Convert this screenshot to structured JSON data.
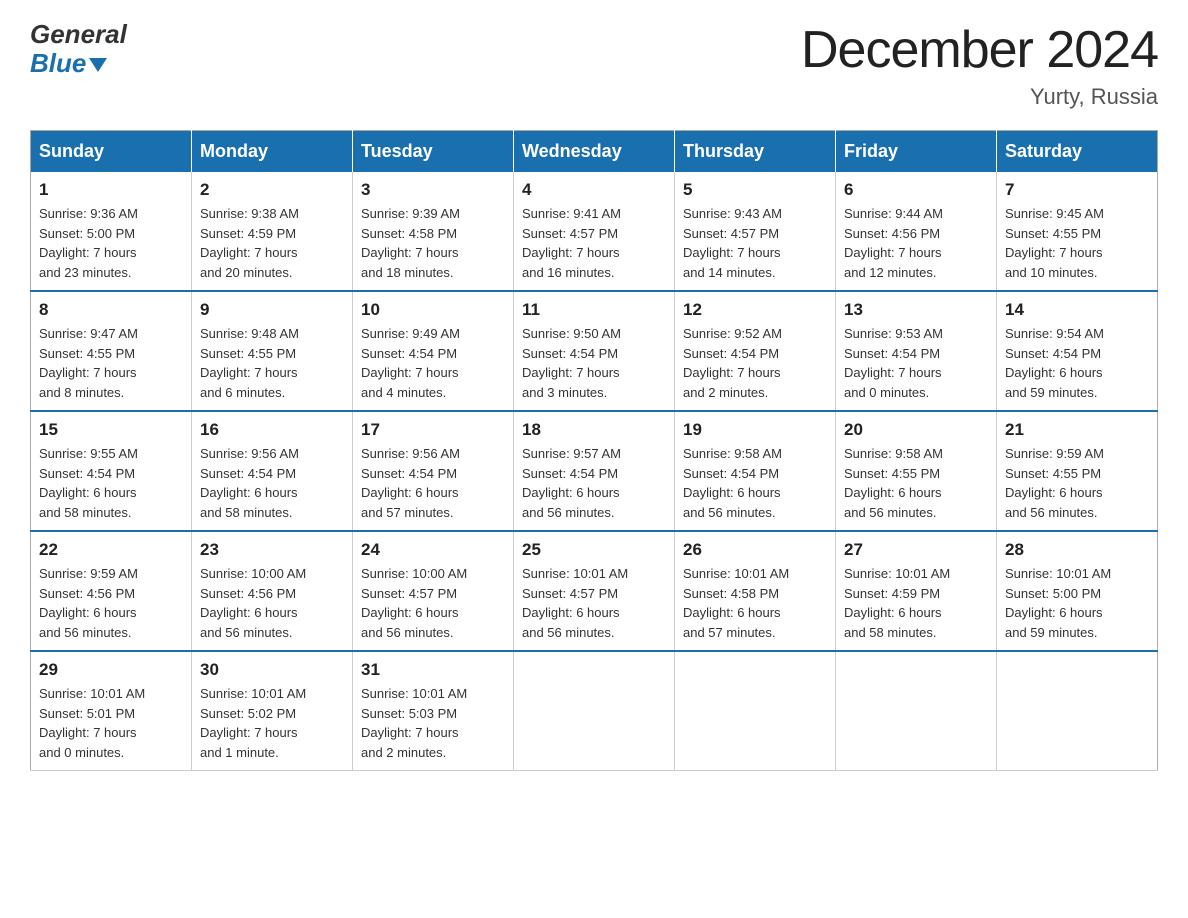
{
  "header": {
    "logo_line1": "General",
    "logo_line2": "Blue",
    "title": "December 2024",
    "subtitle": "Yurty, Russia"
  },
  "weekdays": [
    "Sunday",
    "Monday",
    "Tuesday",
    "Wednesday",
    "Thursday",
    "Friday",
    "Saturday"
  ],
  "weeks": [
    [
      {
        "day": "1",
        "sunrise": "Sunrise: 9:36 AM",
        "sunset": "Sunset: 5:00 PM",
        "daylight": "Daylight: 7 hours",
        "minutes": "and 23 minutes."
      },
      {
        "day": "2",
        "sunrise": "Sunrise: 9:38 AM",
        "sunset": "Sunset: 4:59 PM",
        "daylight": "Daylight: 7 hours",
        "minutes": "and 20 minutes."
      },
      {
        "day": "3",
        "sunrise": "Sunrise: 9:39 AM",
        "sunset": "Sunset: 4:58 PM",
        "daylight": "Daylight: 7 hours",
        "minutes": "and 18 minutes."
      },
      {
        "day": "4",
        "sunrise": "Sunrise: 9:41 AM",
        "sunset": "Sunset: 4:57 PM",
        "daylight": "Daylight: 7 hours",
        "minutes": "and 16 minutes."
      },
      {
        "day": "5",
        "sunrise": "Sunrise: 9:43 AM",
        "sunset": "Sunset: 4:57 PM",
        "daylight": "Daylight: 7 hours",
        "minutes": "and 14 minutes."
      },
      {
        "day": "6",
        "sunrise": "Sunrise: 9:44 AM",
        "sunset": "Sunset: 4:56 PM",
        "daylight": "Daylight: 7 hours",
        "minutes": "and 12 minutes."
      },
      {
        "day": "7",
        "sunrise": "Sunrise: 9:45 AM",
        "sunset": "Sunset: 4:55 PM",
        "daylight": "Daylight: 7 hours",
        "minutes": "and 10 minutes."
      }
    ],
    [
      {
        "day": "8",
        "sunrise": "Sunrise: 9:47 AM",
        "sunset": "Sunset: 4:55 PM",
        "daylight": "Daylight: 7 hours",
        "minutes": "and 8 minutes."
      },
      {
        "day": "9",
        "sunrise": "Sunrise: 9:48 AM",
        "sunset": "Sunset: 4:55 PM",
        "daylight": "Daylight: 7 hours",
        "minutes": "and 6 minutes."
      },
      {
        "day": "10",
        "sunrise": "Sunrise: 9:49 AM",
        "sunset": "Sunset: 4:54 PM",
        "daylight": "Daylight: 7 hours",
        "minutes": "and 4 minutes."
      },
      {
        "day": "11",
        "sunrise": "Sunrise: 9:50 AM",
        "sunset": "Sunset: 4:54 PM",
        "daylight": "Daylight: 7 hours",
        "minutes": "and 3 minutes."
      },
      {
        "day": "12",
        "sunrise": "Sunrise: 9:52 AM",
        "sunset": "Sunset: 4:54 PM",
        "daylight": "Daylight: 7 hours",
        "minutes": "and 2 minutes."
      },
      {
        "day": "13",
        "sunrise": "Sunrise: 9:53 AM",
        "sunset": "Sunset: 4:54 PM",
        "daylight": "Daylight: 7 hours",
        "minutes": "and 0 minutes."
      },
      {
        "day": "14",
        "sunrise": "Sunrise: 9:54 AM",
        "sunset": "Sunset: 4:54 PM",
        "daylight": "Daylight: 6 hours",
        "minutes": "and 59 minutes."
      }
    ],
    [
      {
        "day": "15",
        "sunrise": "Sunrise: 9:55 AM",
        "sunset": "Sunset: 4:54 PM",
        "daylight": "Daylight: 6 hours",
        "minutes": "and 58 minutes."
      },
      {
        "day": "16",
        "sunrise": "Sunrise: 9:56 AM",
        "sunset": "Sunset: 4:54 PM",
        "daylight": "Daylight: 6 hours",
        "minutes": "and 58 minutes."
      },
      {
        "day": "17",
        "sunrise": "Sunrise: 9:56 AM",
        "sunset": "Sunset: 4:54 PM",
        "daylight": "Daylight: 6 hours",
        "minutes": "and 57 minutes."
      },
      {
        "day": "18",
        "sunrise": "Sunrise: 9:57 AM",
        "sunset": "Sunset: 4:54 PM",
        "daylight": "Daylight: 6 hours",
        "minutes": "and 56 minutes."
      },
      {
        "day": "19",
        "sunrise": "Sunrise: 9:58 AM",
        "sunset": "Sunset: 4:54 PM",
        "daylight": "Daylight: 6 hours",
        "minutes": "and 56 minutes."
      },
      {
        "day": "20",
        "sunrise": "Sunrise: 9:58 AM",
        "sunset": "Sunset: 4:55 PM",
        "daylight": "Daylight: 6 hours",
        "minutes": "and 56 minutes."
      },
      {
        "day": "21",
        "sunrise": "Sunrise: 9:59 AM",
        "sunset": "Sunset: 4:55 PM",
        "daylight": "Daylight: 6 hours",
        "minutes": "and 56 minutes."
      }
    ],
    [
      {
        "day": "22",
        "sunrise": "Sunrise: 9:59 AM",
        "sunset": "Sunset: 4:56 PM",
        "daylight": "Daylight: 6 hours",
        "minutes": "and 56 minutes."
      },
      {
        "day": "23",
        "sunrise": "Sunrise: 10:00 AM",
        "sunset": "Sunset: 4:56 PM",
        "daylight": "Daylight: 6 hours",
        "minutes": "and 56 minutes."
      },
      {
        "day": "24",
        "sunrise": "Sunrise: 10:00 AM",
        "sunset": "Sunset: 4:57 PM",
        "daylight": "Daylight: 6 hours",
        "minutes": "and 56 minutes."
      },
      {
        "day": "25",
        "sunrise": "Sunrise: 10:01 AM",
        "sunset": "Sunset: 4:57 PM",
        "daylight": "Daylight: 6 hours",
        "minutes": "and 56 minutes."
      },
      {
        "day": "26",
        "sunrise": "Sunrise: 10:01 AM",
        "sunset": "Sunset: 4:58 PM",
        "daylight": "Daylight: 6 hours",
        "minutes": "and 57 minutes."
      },
      {
        "day": "27",
        "sunrise": "Sunrise: 10:01 AM",
        "sunset": "Sunset: 4:59 PM",
        "daylight": "Daylight: 6 hours",
        "minutes": "and 58 minutes."
      },
      {
        "day": "28",
        "sunrise": "Sunrise: 10:01 AM",
        "sunset": "Sunset: 5:00 PM",
        "daylight": "Daylight: 6 hours",
        "minutes": "and 59 minutes."
      }
    ],
    [
      {
        "day": "29",
        "sunrise": "Sunrise: 10:01 AM",
        "sunset": "Sunset: 5:01 PM",
        "daylight": "Daylight: 7 hours",
        "minutes": "and 0 minutes."
      },
      {
        "day": "30",
        "sunrise": "Sunrise: 10:01 AM",
        "sunset": "Sunset: 5:02 PM",
        "daylight": "Daylight: 7 hours",
        "minutes": "and 1 minute."
      },
      {
        "day": "31",
        "sunrise": "Sunrise: 10:01 AM",
        "sunset": "Sunset: 5:03 PM",
        "daylight": "Daylight: 7 hours",
        "minutes": "and 2 minutes."
      },
      null,
      null,
      null,
      null
    ]
  ]
}
